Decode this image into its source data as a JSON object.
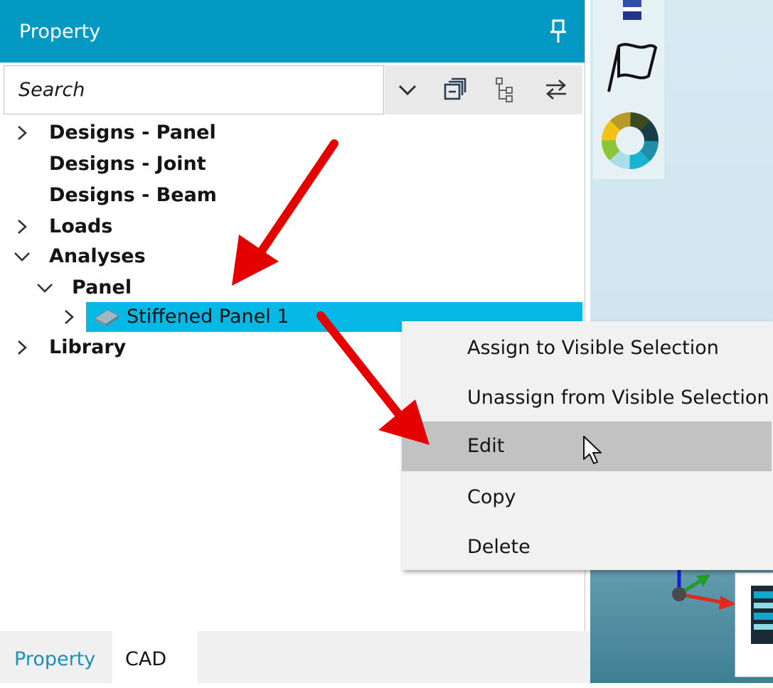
{
  "panel": {
    "title": "Property",
    "search": {
      "placeholder": "Search",
      "value": ""
    },
    "toolbar": [
      "chevron-down-icon",
      "collapse-all-icon",
      "tree-view-icon",
      "swap-icon"
    ]
  },
  "tree": {
    "designs_panel": "Designs - Panel",
    "designs_joint": "Designs - Joint",
    "designs_beam": "Designs - Beam",
    "loads": "Loads",
    "analyses": "Analyses",
    "panel": "Panel",
    "stiffened_panel": "Stiffened Panel 1",
    "library": "Library"
  },
  "context_menu": {
    "items": [
      "Assign to Visible Selection",
      "Unassign from Visible Selection",
      "Edit",
      "Copy",
      "Delete"
    ],
    "highlighted": "Edit"
  },
  "tabs": [
    {
      "label": "Property",
      "active": true
    },
    {
      "label": "CAD",
      "active": false
    }
  ],
  "colors": {
    "header": "#0499c2",
    "selection": "#05b8e6",
    "active_tab_text": "#1b8fb8",
    "menu_highlight": "#c2c2c2",
    "annotation_arrow": "#e50000"
  }
}
